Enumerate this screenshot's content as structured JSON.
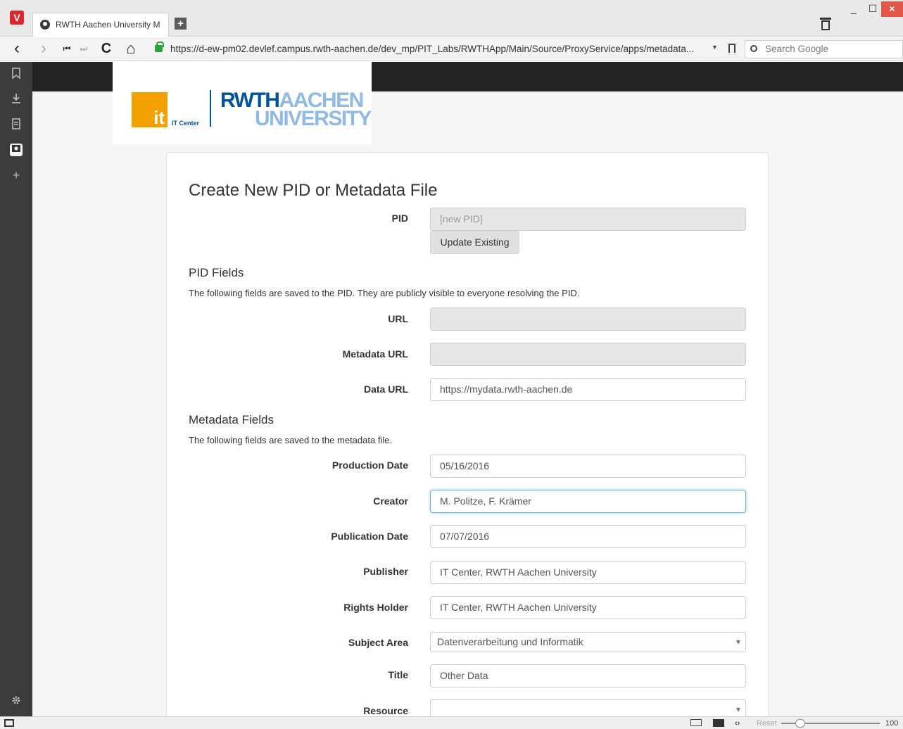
{
  "browser": {
    "tab_title": "RWTH Aachen University M",
    "url": "https://d-ew-pm02.devlef.campus.rwth-aachen.de/dev_mp/PIT_Labs/RWTHApp/Main/Source/ProxyService/apps/metadata...",
    "search_placeholder": "Search Google",
    "logo_letter": "V",
    "new_tab": "+",
    "win_min": "_",
    "win_max": "☐",
    "win_close": "×",
    "nav_back": "‹",
    "nav_forward": "›",
    "nav_first": "⏮",
    "nav_last": "⏭",
    "nav_reload": "C",
    "nav_home": "⌂",
    "url_drop": "▼",
    "search_drop": "▼",
    "statusbar": {
      "reset": "Reset",
      "zoom": "100"
    }
  },
  "logo": {
    "it_letters": "it",
    "it_center": "IT Center",
    "rwth_dark": "RWTH",
    "rwth_light": "AACHEN",
    "university": "UNIVERSITY"
  },
  "form": {
    "title": "Create New PID or Metadata File",
    "pid_label": "PID",
    "pid_placeholder": "[new PID]",
    "update_button": "Update Existing",
    "pid_fields_heading": "PID Fields",
    "pid_fields_help": "The following fields are saved to the PID. They are publicly visible to everyone resolving the PID.",
    "url_label": "URL",
    "url_value": "",
    "metadata_url_label": "Metadata URL",
    "metadata_url_value": "",
    "data_url_label": "Data URL",
    "data_url_value": "https://mydata.rwth-aachen.de",
    "metadata_fields_heading": "Metadata Fields",
    "metadata_fields_help": "The following fields are saved to the metadata file.",
    "production_date_label": "Production Date",
    "production_date_value": "05/16/2016",
    "creator_label": "Creator",
    "creator_value": "M. Politze, F. Krämer",
    "publication_date_label": "Publication Date",
    "publication_date_value": "07/07/2016",
    "publisher_label": "Publisher",
    "publisher_value": "IT Center, RWTH Aachen University",
    "rights_holder_label": "Rights Holder",
    "rights_holder_value": "IT Center, RWTH Aachen University",
    "subject_area_label": "Subject Area",
    "subject_area_value": "Datenverarbeitung und Informatik",
    "title_label": "Title",
    "title_value": "Other Data",
    "resource_label": "Resource",
    "resource_value": ""
  }
}
